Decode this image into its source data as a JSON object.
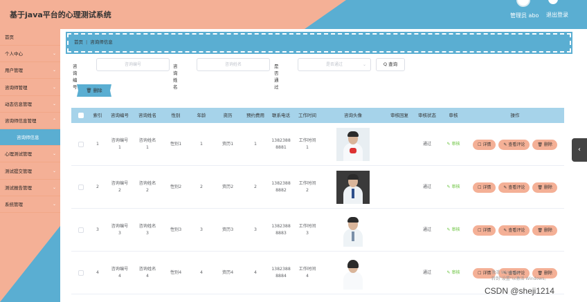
{
  "header": {
    "app_title": "基于java平台的心理测试系统",
    "user_info": "管理员 abo",
    "logout": "退出登录"
  },
  "sidebar": {
    "items": [
      {
        "label": "首页",
        "arrow": ""
      },
      {
        "label": "个人中心",
        "arrow": "⌄"
      },
      {
        "label": "用户管理",
        "arrow": "⌄"
      },
      {
        "label": "咨询师管理",
        "arrow": "⌄"
      },
      {
        "label": "动态信息管理",
        "arrow": "⌄"
      },
      {
        "label": "咨询师信息管理",
        "arrow": "⌃"
      },
      {
        "label": "咨询师信息",
        "arrow": ""
      },
      {
        "label": "心理测试管理",
        "arrow": "⌄"
      },
      {
        "label": "测试提交管理",
        "arrow": "⌄"
      },
      {
        "label": "测试报告管理",
        "arrow": "⌄"
      },
      {
        "label": "系统管理",
        "arrow": "⌄"
      }
    ]
  },
  "breadcrumb": {
    "home": "首页",
    "separator": "|",
    "current": "咨询师信息"
  },
  "search": {
    "label_no": "咨询编号",
    "placeholder_no": "咨询编号",
    "label_name": "咨询姓名",
    "placeholder_name": "咨询姓名",
    "label_pass": "是否通过",
    "placeholder_pass": "是否通过",
    "search_button": "Q 查询"
  },
  "actions": {
    "delete_label": "🗑 删除"
  },
  "table": {
    "headers": [
      "",
      "索引",
      "咨询编号",
      "咨询姓名",
      "性别",
      "年龄",
      "资历",
      "预约费用",
      "联系电话",
      "工作时间",
      "咨询头像",
      "审核回复",
      "审核状态",
      "审核",
      "操作"
    ],
    "review_label": "✎ 审核",
    "btn_detail": "☐ 详情",
    "btn_comment": "✎ 查看评论",
    "btn_delete": "🗑 删除",
    "rows": [
      {
        "index": "1",
        "no": "咨询编号\n1",
        "name": "咨询姓名\n1",
        "gender": "性别1",
        "age": "1",
        "qual": "资历1",
        "fee": "1",
        "phone": "1382388\n8881",
        "work": "工作时间\n1",
        "reply": "",
        "status": "通过"
      },
      {
        "index": "2",
        "no": "咨询编号\n2",
        "name": "咨询姓名\n2",
        "gender": "性别2",
        "age": "2",
        "qual": "资历2",
        "fee": "2",
        "phone": "1382388\n8882",
        "work": "工作时间\n2",
        "reply": "",
        "status": "通过"
      },
      {
        "index": "3",
        "no": "咨询编号\n3",
        "name": "咨询姓名\n3",
        "gender": "性别3",
        "age": "3",
        "qual": "资历3",
        "fee": "3",
        "phone": "1382388\n8883",
        "work": "工作时间\n3",
        "reply": "",
        "status": "通过"
      },
      {
        "index": "4",
        "no": "咨询编号\n4",
        "name": "咨询姓名\n4",
        "gender": "性别4",
        "age": "4",
        "qual": "资历4",
        "fee": "4",
        "phone": "1382388\n8884",
        "work": "工作时间\n4",
        "reply": "",
        "status": "通过"
      }
    ]
  },
  "side_tab": "‹",
  "watermark": {
    "line1": "激活 Windows",
    "line2": "转到\"设置\"以激活 Windows。"
  },
  "csdn": "CSDN @sheji1214",
  "colors": {
    "accent_peach": "#f4b096",
    "accent_blue": "#5aaed2",
    "table_header": "#a6d3ea"
  }
}
